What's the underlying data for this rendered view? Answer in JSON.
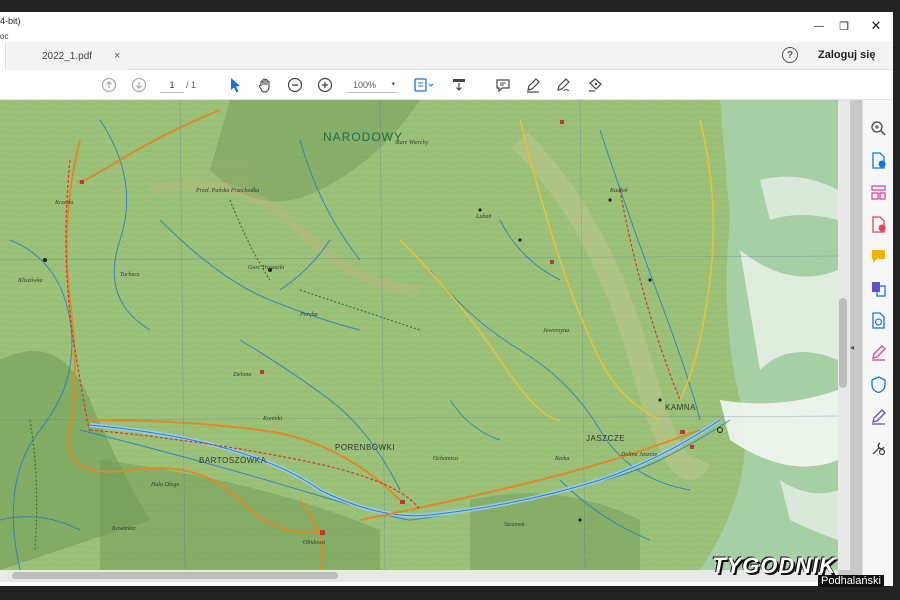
{
  "window": {
    "title": "4-bit)",
    "menu_fragment": "oc",
    "controls": {
      "minimize": "—",
      "maximize": "❐",
      "close": "✕"
    }
  },
  "tabs": {
    "document": {
      "name": "2022_1.pdf",
      "close": "×"
    },
    "help": "?",
    "login": "Zaloguj się"
  },
  "toolbar": {
    "page_current": "1",
    "page_total": "/ 1",
    "zoom": "100%",
    "zoom_caret": "▾",
    "icons": [
      "arrow-up-icon",
      "arrow-down-icon",
      "select-cursor-icon",
      "hand-icon",
      "zoom-out-icon",
      "zoom-in-icon",
      "fit-page-icon",
      "scroll-mode-icon",
      "comment-icon",
      "highlight-pen-icon",
      "sign-icon",
      "stamp-icon"
    ],
    "accent_color": "#1473e6"
  },
  "map": {
    "labels": {
      "narodowy": "NARODOWY",
      "porebowki": "PORENBÓWKI",
      "bartosowka": "BARTOSZÓWKA",
      "jaszcze": "JASZCZE",
      "kamna": "KAMNA",
      "krzywe": "Przeł. Pańska Przechodka",
      "turbacz_label": "Turbacz",
      "klikuszowa": "Kliszówka",
      "krzeslo": "Krzesło",
      "stare_wierchy": "Stare Wierchy",
      "gorc_label": "Gorc Troszacki",
      "lubien": "Lubań",
      "poreba": "Poręba",
      "ochotnica": "Ochotnica",
      "kudlon": "Kudłoń",
      "jaworzyna": "Jaworzyna",
      "hala": "Hala Długa",
      "koninki": "Koninki",
      "szczawa": "Szczawa",
      "rzeka": "Rzeka",
      "dolina": "Dolina Jaszcze",
      "kowaniec": "Kowaniec",
      "obidowa": "Obidowa",
      "zielona": "Zielona"
    },
    "colors": {
      "base_green": "#9cc27a",
      "dark_green": "#6f9a54",
      "light_green": "#b8d48e",
      "river_blue": "#2e7fc1",
      "road_orange": "#e08a2a",
      "trail_red": "#d8352a",
      "trail_yellow": "#e6c23a"
    }
  },
  "right_panel": {
    "icons": [
      "search-zoom-icon",
      "export-pdf-icon",
      "organize-pages-icon",
      "create-pdf-icon",
      "comment-tool-icon",
      "combine-files-icon",
      "scan-ocr-icon",
      "fill-sign-icon",
      "protect-icon",
      "request-signature-icon",
      "more-tools-icon"
    ],
    "collapse": "◂"
  },
  "watermark": {
    "main": "TYGODNIK",
    "sub": "Podhalański"
  }
}
